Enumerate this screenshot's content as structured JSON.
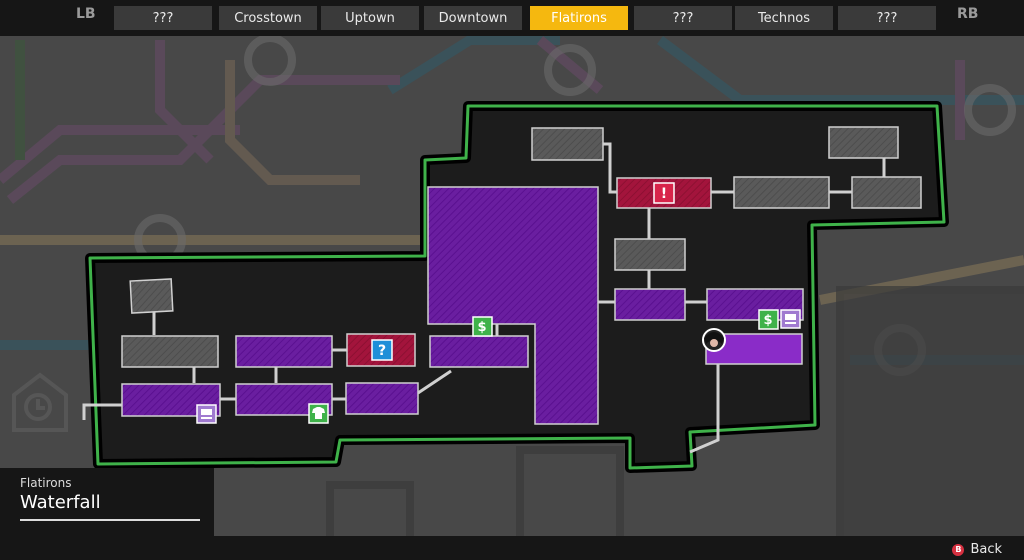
{
  "top_nav": {
    "left_bumper": "LB",
    "right_bumper": "RB",
    "tabs": [
      {
        "label": "???"
      },
      {
        "label": "Crosstown"
      },
      {
        "label": "Uptown"
      },
      {
        "label": "Downtown"
      },
      {
        "label": "Flatirons",
        "active": true
      },
      {
        "label": "???"
      },
      {
        "label": "Technos"
      },
      {
        "label": "???"
      }
    ]
  },
  "location": {
    "district": "Flatirons",
    "name": "Waterfall"
  },
  "footer": {
    "back_button_glyph": "B",
    "back_label": "Back"
  },
  "map": {
    "room_markers": {
      "quest": "!",
      "mystery": "?",
      "shop": "$"
    }
  },
  "colors": {
    "tab_active": "#f5b80f",
    "map_border": "#3fb24a",
    "room_visited": "#6a1ea0",
    "room_unknown": "#5a5a5a",
    "room_special": "#a3143c",
    "icon_shop": "#3fb24a",
    "icon_transit": "#a07ad0",
    "button_b": "#d63040"
  }
}
